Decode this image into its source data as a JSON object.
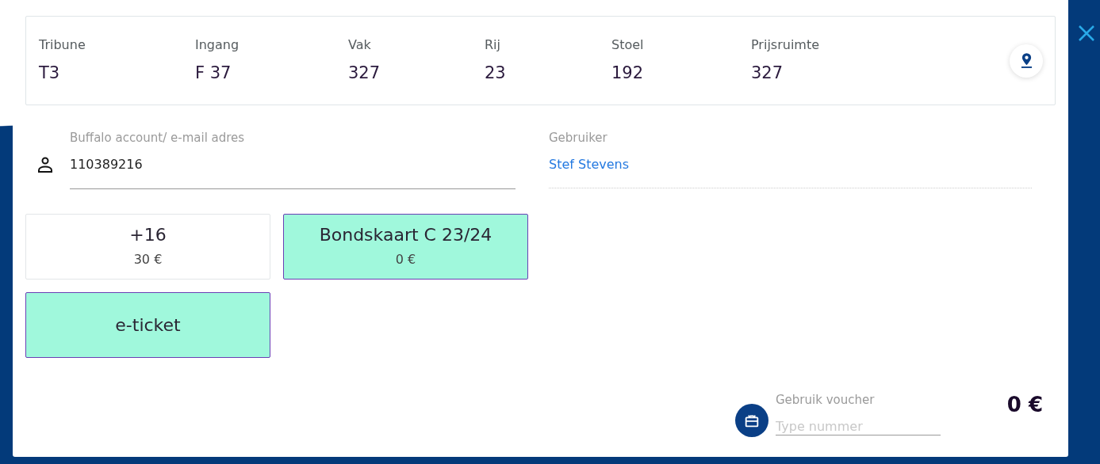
{
  "seat_info": [
    {
      "label": "Tribune",
      "value": "T3"
    },
    {
      "label": "Ingang",
      "value": "F 37"
    },
    {
      "label": "Vak",
      "value": "327"
    },
    {
      "label": "Rij",
      "value": "23"
    },
    {
      "label": "Stoel",
      "value": "192"
    },
    {
      "label": "Prijsruimte",
      "value": "327"
    }
  ],
  "account": {
    "label": "Buffalo account/ e-mail adres",
    "value": "110389216"
  },
  "user": {
    "label": "Gebruiker",
    "value": "Stef Stevens"
  },
  "price_options": [
    {
      "title": "+16",
      "price": "30 €",
      "selected": false
    },
    {
      "title": "Bondskaart C 23/24",
      "price": "0 €",
      "selected": true
    }
  ],
  "delivery_options": [
    {
      "title": "e-ticket",
      "selected": true
    }
  ],
  "voucher": {
    "label": "Gebruik voucher",
    "placeholder": "Type nummer"
  },
  "total": "0 €"
}
